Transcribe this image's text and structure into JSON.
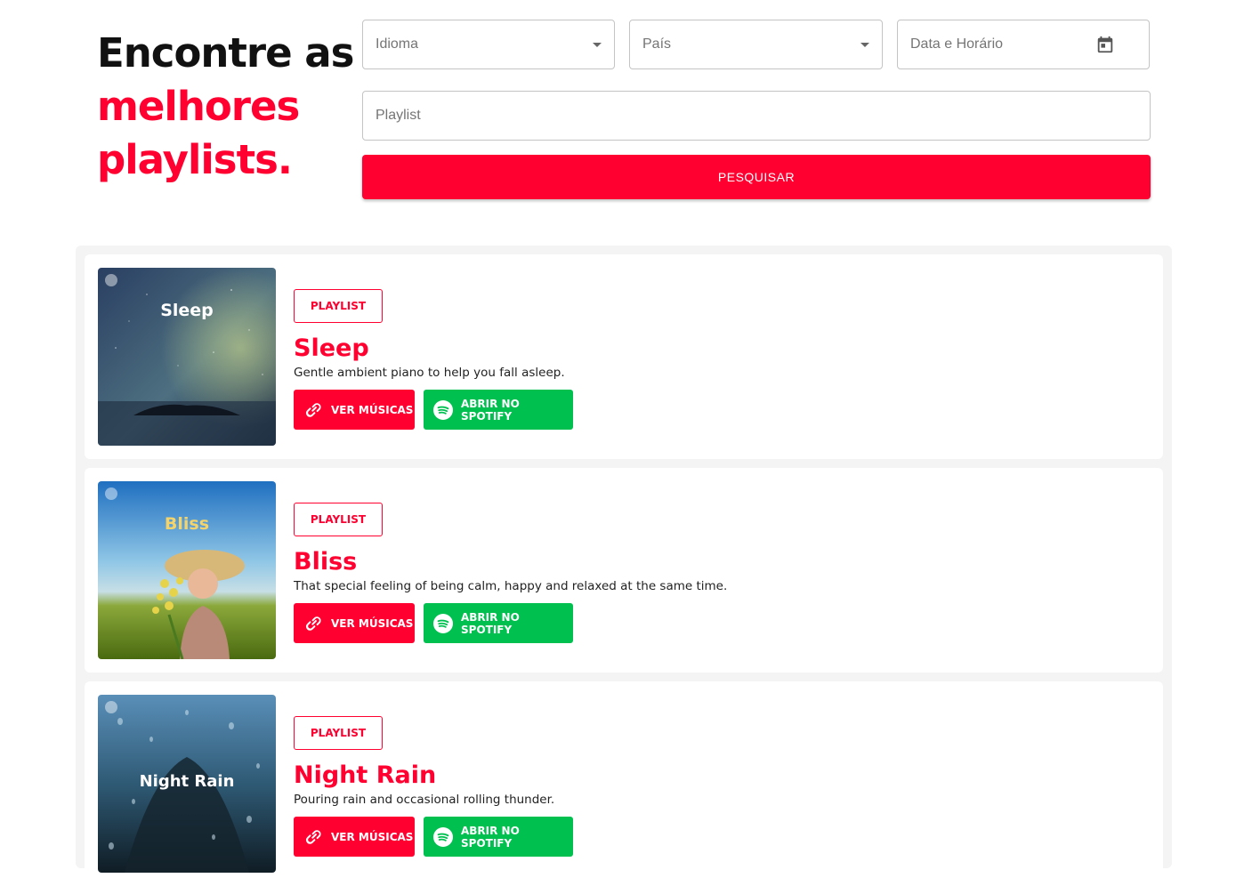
{
  "hero": {
    "line1": "Encontre as",
    "line2": "melhores",
    "line3": "playlists."
  },
  "filters": {
    "idioma": "Idioma",
    "pais": "País",
    "data_horario": "Data e Horário",
    "playlist": "Playlist",
    "search_label": "PESQUISAR"
  },
  "colors": {
    "accent": "#ff0030",
    "spotify": "#00c050"
  },
  "cards": [
    {
      "badge": "PLAYLIST",
      "title": "Sleep",
      "description": "Gentle ambient piano to help you fall asleep.",
      "cover_text": "Sleep",
      "ver_label": "VER MÚSICAS",
      "spotify_label": "ABRIR NO SPOTIFY"
    },
    {
      "badge": "PLAYLIST",
      "title": "Bliss",
      "description": "That special feeling of being calm, happy and relaxed at the same time.",
      "cover_text": "Bliss",
      "ver_label": "VER MÚSICAS",
      "spotify_label": "ABRIR NO SPOTIFY"
    },
    {
      "badge": "PLAYLIST",
      "title": "Night Rain",
      "description": "Pouring rain and occasional rolling thunder.",
      "cover_text": "Night Rain",
      "ver_label": "VER MÚSICAS",
      "spotify_label": "ABRIR NO SPOTIFY"
    }
  ]
}
